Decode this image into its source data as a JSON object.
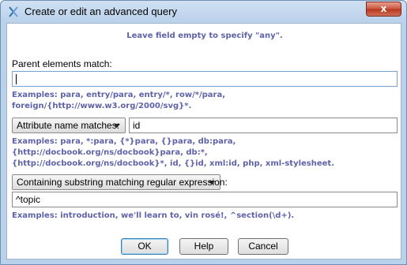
{
  "window": {
    "title": "Create or edit an advanced query",
    "close_label": "x"
  },
  "hint": "Leave field empty to specify \"any\".",
  "parent": {
    "label": "Parent elements match:",
    "value": "",
    "examples": "Examples: para, entry/para, entry/*, row/*/para, foreign/{http://www.w3.org/2000/svg}*."
  },
  "attribute": {
    "combo_label": "Attribute name matches:",
    "value": "id",
    "examples_line1": "Examples: para, *:para, {*}para, {}para, db:para, {http://docbook.org/ns/docbook}para, db:*,",
    "examples_line2": "{http://docbook.org/ns/docbook}*, id, {}id, xml:id, php, xml-stylesheet."
  },
  "substring": {
    "combo_label": "Containing substring matching regular expression:",
    "value": "^topic",
    "examples": "Examples: introduction, we'll learn to, vin rosé!, ^section(\\d+)."
  },
  "buttons": {
    "ok": "OK",
    "help": "Help",
    "cancel": "Cancel"
  }
}
